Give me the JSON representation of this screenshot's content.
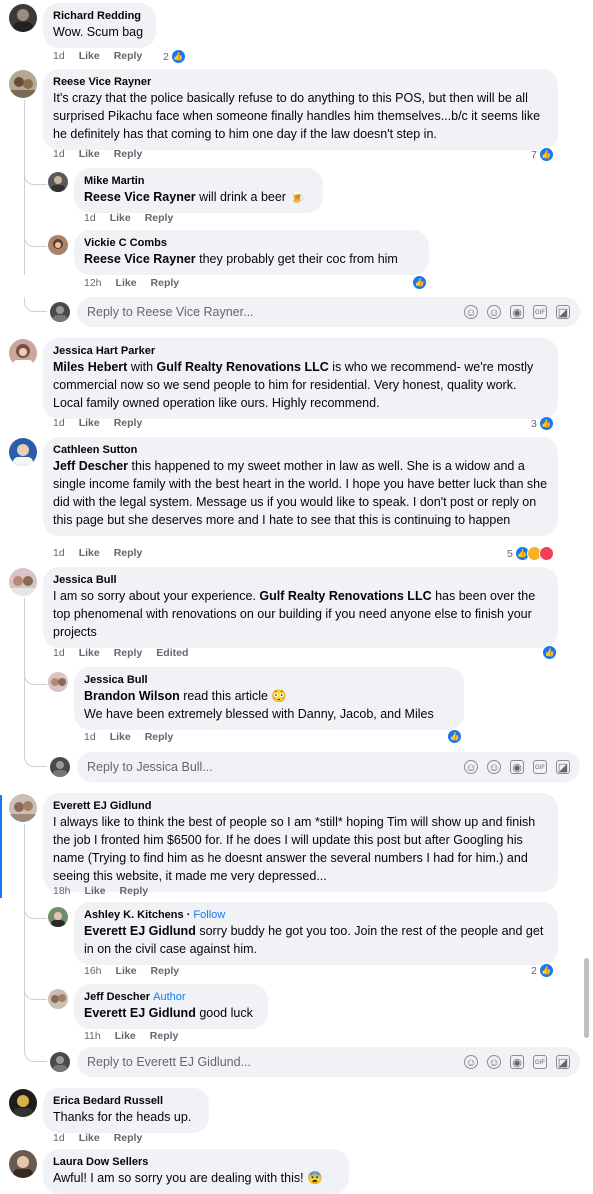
{
  "comments": [
    {
      "id": "c1",
      "name": "Richard Redding",
      "text": "Wow. Scum bag",
      "time": "1d",
      "like": "Like",
      "reply": "Reply",
      "reactions": "2"
    },
    {
      "id": "c2",
      "name": "Reese Vice Rayner",
      "text": "It's crazy that the police basically refuse to do anything to this POS, but then will be all surprised Pikachu face when someone finally handles him themselves...b/c it seems like he definitely has that coming to him one day if the law doesn't step in.",
      "time": "1d",
      "like": "Like",
      "reply": "Reply",
      "reactions": "7",
      "replies": [
        {
          "name": "Mike Martin",
          "tag": "Reese Vice Rayner",
          "text": " will drink a beer 🍺",
          "time": "1d",
          "like": "Like",
          "reply": "Reply"
        },
        {
          "name": "Vickie C Combs",
          "tag": "Reese Vice Rayner",
          "text": " they probably get their coc from him",
          "time": "12h",
          "like": "Like",
          "reply": "Reply",
          "reactions": ""
        }
      ],
      "reply_placeholder": "Reply to Reese Vice Rayner..."
    },
    {
      "id": "c3",
      "name": "Jessica Hart Parker",
      "tag": "Miles Hebert",
      "pre": " with ",
      "tag2": "Gulf Realty Renovations LLC",
      "text": " is who we recommend- we're mostly commercial now so we send people to him for residential. Very honest, quality work. Local family owned operation like ours. Highly recommend.",
      "time": "1d",
      "like": "Like",
      "reply": "Reply",
      "reactions": "3"
    },
    {
      "id": "c4",
      "name": "Cathleen Sutton",
      "tag": "Jeff Descher",
      "text": " this happened to my sweet mother in law as well. She is a widow and a single income family with the best heart in the world. I hope you have better luck than she did with the legal system. Message us if you would like to speak. I don't post or reply on this page but she deserves more and I hate to see that this is continuing to happen",
      "time": "1d",
      "like": "Like",
      "reply": "Reply",
      "reactions": "5"
    },
    {
      "id": "c5",
      "name": "Jessica Bull",
      "pre": "I am so sorry about your experience. ",
      "tag": "Gulf Realty Renovations LLC",
      "text": " has been over the top phenomenal with renovations on our building if you need anyone else to finish your projects",
      "time": "1d",
      "like": "Like",
      "reply": "Reply",
      "edited": "Edited",
      "reactions": "",
      "replies": [
        {
          "name": "Jessica Bull",
          "tag": "Brandon Wilson",
          "text": " read this article 😳",
          "line2": "We have been extremely blessed with Danny, Jacob, and Miles",
          "time": "1d",
          "like": "Like",
          "reply": "Reply",
          "reactions": ""
        }
      ],
      "reply_placeholder": "Reply to Jessica Bull..."
    },
    {
      "id": "c6",
      "name": "Everett EJ Gidlund",
      "text": "I always like to think the best of people so I am *still* hoping Tim will show up and finish the job I fronted him $6500 for. If he does I will update this post but after Googling his name (Trying to find him as he doesnt answer the several numbers I had for him.) and seeing this website, it made me very depressed...",
      "time": "18h",
      "like": "Like",
      "reply": "Reply",
      "replies": [
        {
          "name": "Ashley K. Kitchens",
          "badge": "Follow",
          "tag": "Everett EJ Gidlund",
          "text": " sorry buddy he got you too. Join the rest of the people and get in on the civil case against him.",
          "time": "16h",
          "like": "Like",
          "reply": "Reply",
          "reactions": "2"
        },
        {
          "name": "Jeff Descher",
          "badge": "Author",
          "tag": "Everett EJ Gidlund",
          "text": " good luck",
          "time": "11h",
          "like": "Like",
          "reply": "Reply"
        }
      ],
      "reply_placeholder": "Reply to Everett EJ Gidlund..."
    },
    {
      "id": "c7",
      "name": "Erica Bedard Russell",
      "text": "Thanks for the heads up.",
      "time": "1d",
      "like": "Like",
      "reply": "Reply"
    },
    {
      "id": "c8",
      "name": "Laura Dow Sellers",
      "text": "Awful! I am so sorry you are dealing with this! 😨"
    }
  ],
  "colors": {
    "accent": "#1877f2",
    "bubble": "#f0f2f5",
    "meta": "#65676b"
  },
  "icons": [
    "like-icon",
    "haha-icon",
    "love-icon",
    "gif-icon",
    "camera-icon",
    "emoji-icon",
    "avatar-icon",
    "sticker-icon"
  ]
}
